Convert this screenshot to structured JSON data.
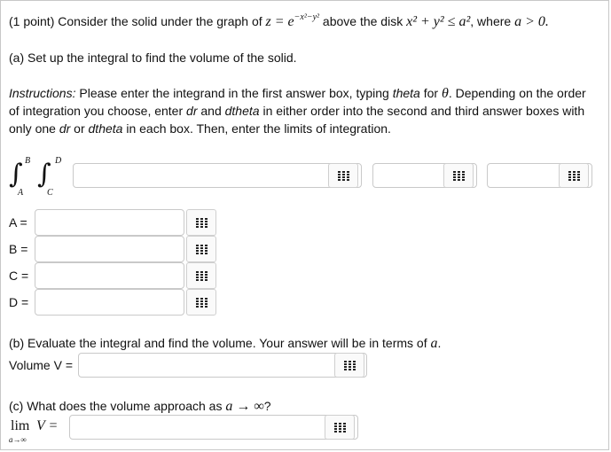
{
  "problem": {
    "prefix": "(1 point) Consider the solid under the graph of",
    "graph_eq": "z = e",
    "graph_exp": "−x²−y²",
    "mid": "above the disk",
    "disk_ineq": "x² + y² ≤ a²",
    "suffix": ", where",
    "condition": "a > 0."
  },
  "part_a": {
    "prompt": "(a) Set up the integral to find the volume of the solid.",
    "instructions_label": "Instructions:",
    "instructions_1a": "Please enter the integrand in the first answer box, typing",
    "instructions_1b": "theta",
    "instructions_1c": "for",
    "instructions_1d": "θ",
    "instructions_1e": ". Depending on the order",
    "instructions_2a": "of integration you choose, enter",
    "instructions_2b": "dr",
    "instructions_2c": "and",
    "instructions_2d": "dtheta",
    "instructions_2e": "in either order into the second and third answer boxes with",
    "instructions_3a": "only one",
    "instructions_3b": "dr",
    "instructions_3c": "or",
    "instructions_3d": "dtheta",
    "instructions_3e": "in each box. Then, enter the limits of integration.",
    "upper_outer": "B",
    "lower_outer": "A",
    "upper_inner": "D",
    "lower_inner": "C",
    "integral_symbol": "∫",
    "limits": [
      {
        "label": "A =",
        "value": ""
      },
      {
        "label": "B =",
        "value": ""
      },
      {
        "label": "C =",
        "value": ""
      },
      {
        "label": "D =",
        "value": ""
      }
    ]
  },
  "part_b": {
    "prompt": "(b) Evaluate the integral and find the volume. Your answer will be in terms of",
    "var": "a",
    "period": ".",
    "volume_label": "Volume V ="
  },
  "part_c": {
    "prompt": "(c) What does the volume approach as",
    "arrow": "a → ∞",
    "qmark": "?",
    "lim_label": "lim",
    "lim_var": "V =",
    "lim_sub": "a→∞"
  }
}
